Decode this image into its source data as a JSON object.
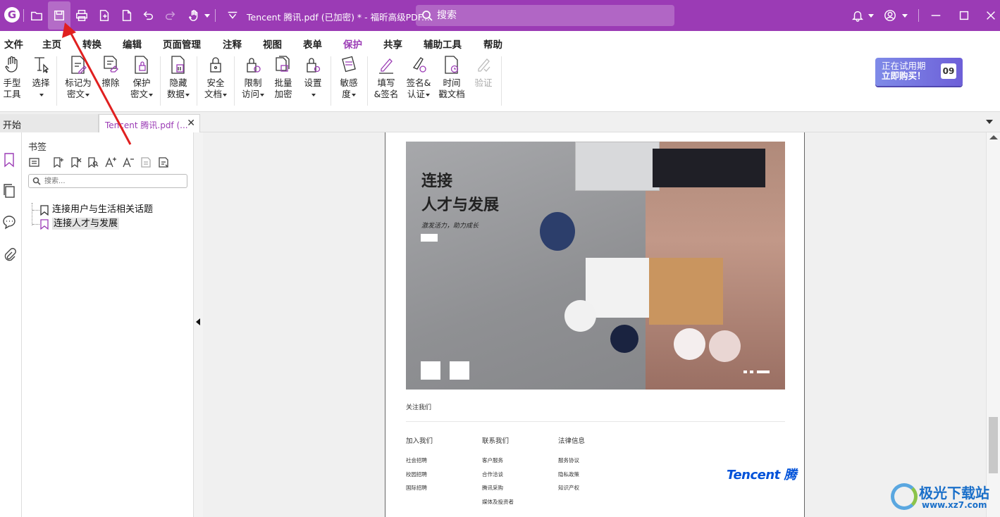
{
  "titlebar": {
    "logo": "G",
    "title": "Tencent 腾讯.pdf (已加密) * - 福昕高级PDF...",
    "search_placeholder": "搜索",
    "icons": [
      "open-folder-icon",
      "save-icon",
      "print-icon",
      "new-document-icon",
      "add-page-icon",
      "undo-icon",
      "redo-icon",
      "hand-icon",
      "dropdown-icon",
      "bell-icon",
      "user-icon",
      "minimize-icon",
      "maximize-icon",
      "close-icon"
    ]
  },
  "menu": {
    "items": [
      "文件",
      "主页",
      "转换",
      "编辑",
      "页面管理",
      "注释",
      "视图",
      "表单",
      "保护",
      "共享",
      "辅助工具",
      "帮助"
    ],
    "active": "保护"
  },
  "ribbon": {
    "buttons": [
      {
        "l1": "手型",
        "l2": "工具",
        "icon": "hand-icon"
      },
      {
        "l1": "选择",
        "l2": "",
        "icon": "select-text-icon"
      },
      {
        "l1": "标记为",
        "l2": "密文",
        "icon": "mark-redaction-icon"
      },
      {
        "l1": "擦除",
        "l2": "",
        "icon": "erase-icon"
      },
      {
        "l1": "保护",
        "l2": "密文",
        "icon": "protect-redaction-icon"
      },
      {
        "l1": "隐藏",
        "l2": "数据",
        "icon": "hide-data-icon"
      },
      {
        "l1": "安全",
        "l2": "文档",
        "icon": "secure-document-icon"
      },
      {
        "l1": "限制",
        "l2": "访问",
        "icon": "restrict-access-icon"
      },
      {
        "l1": "批量",
        "l2": "加密",
        "icon": "batch-encrypt-icon"
      },
      {
        "l1": "设置",
        "l2": "",
        "icon": "settings-lock-icon"
      },
      {
        "l1": "敏感",
        "l2": "度",
        "icon": "sensitivity-icon"
      },
      {
        "l1": "填写",
        "l2": "&签名",
        "icon": "fill-sign-icon"
      },
      {
        "l1": "签名&",
        "l2": "认证",
        "icon": "sign-certify-icon"
      },
      {
        "l1": "时间",
        "l2": "戳文档",
        "icon": "timestamp-icon"
      },
      {
        "l1": "验证",
        "l2": "",
        "icon": "validate-icon"
      }
    ],
    "trial": {
      "line1": "正在试用期",
      "line2": "立即购买！",
      "days": "09"
    }
  },
  "tabs": {
    "start": "开始",
    "document": "Tencent 腾讯.pdf (..."
  },
  "bookmarks": {
    "title": "书签",
    "search_placeholder": "搜索...",
    "items": [
      "连接用户与生活相关话题",
      "连接人才与发展"
    ],
    "selected_index": 1
  },
  "page": {
    "hero_title_1": "连接",
    "hero_title_2": "人才与发展",
    "hero_subtitle": "激发活力，助力成长",
    "follow_us": "关注我们",
    "columns": [
      {
        "header": "加入我们",
        "rows": [
          "社会招聘",
          "校园招聘",
          "国际招聘"
        ]
      },
      {
        "header": "联系我们",
        "rows": [
          "客户服务",
          "合作洽谈",
          "腾讯采购",
          "媒体及投资者"
        ]
      },
      {
        "header": "法律信息",
        "rows": [
          "服务协议",
          "隐私政策",
          "知识产权"
        ]
      }
    ],
    "logo_text": "Tencent 腾"
  },
  "watermark": {
    "text": "极光下载站",
    "url": "www.xz7.com"
  }
}
